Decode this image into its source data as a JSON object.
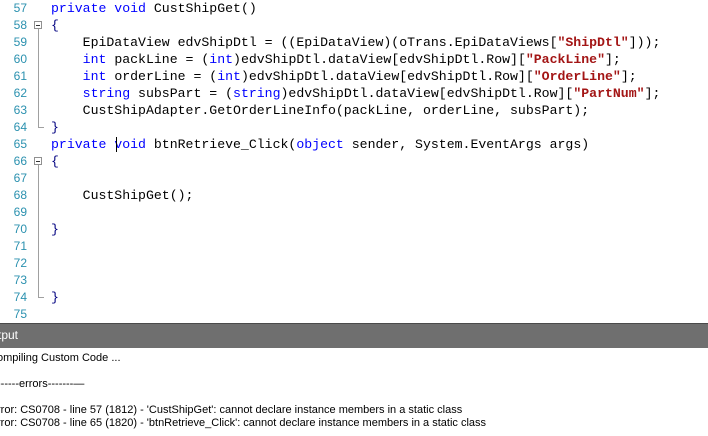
{
  "editor": {
    "lines": [
      {
        "num": "57",
        "fold": "none",
        "tokens": [
          {
            "t": "private void ",
            "c": "kw"
          },
          {
            "t": "CustShipGet()",
            "c": ""
          }
        ]
      },
      {
        "num": "58",
        "fold": "open",
        "tokens": [
          {
            "t": "{",
            "c": "brace"
          }
        ]
      },
      {
        "num": "59",
        "fold": "line",
        "tokens": [
          {
            "t": "    EpiDataView edvShipDtl = ((EpiDataView)(oTrans.EpiDataViews[",
            "c": ""
          },
          {
            "t": "\"ShipDtl\"",
            "c": "str"
          },
          {
            "t": "]));",
            "c": ""
          }
        ]
      },
      {
        "num": "60",
        "fold": "line",
        "tokens": [
          {
            "t": "    ",
            "c": ""
          },
          {
            "t": "int",
            "c": "kw"
          },
          {
            "t": " packLine = (",
            "c": ""
          },
          {
            "t": "int",
            "c": "kw"
          },
          {
            "t": ")edvShipDtl.dataView[edvShipDtl.Row][",
            "c": ""
          },
          {
            "t": "\"PackLine\"",
            "c": "str"
          },
          {
            "t": "];",
            "c": ""
          }
        ]
      },
      {
        "num": "61",
        "fold": "line",
        "tokens": [
          {
            "t": "    ",
            "c": ""
          },
          {
            "t": "int",
            "c": "kw"
          },
          {
            "t": " orderLine = (",
            "c": ""
          },
          {
            "t": "int",
            "c": "kw"
          },
          {
            "t": ")edvShipDtl.dataView[edvShipDtl.Row][",
            "c": ""
          },
          {
            "t": "\"OrderLine\"",
            "c": "str"
          },
          {
            "t": "];",
            "c": ""
          }
        ]
      },
      {
        "num": "62",
        "fold": "line",
        "tokens": [
          {
            "t": "    ",
            "c": ""
          },
          {
            "t": "string",
            "c": "kw"
          },
          {
            "t": " subsPart = (",
            "c": ""
          },
          {
            "t": "string",
            "c": "kw"
          },
          {
            "t": ")edvShipDtl.dataView[edvShipDtl.Row][",
            "c": ""
          },
          {
            "t": "\"PartNum\"",
            "c": "str"
          },
          {
            "t": "];",
            "c": ""
          }
        ]
      },
      {
        "num": "63",
        "fold": "line",
        "tokens": [
          {
            "t": "    CustShipAdapter.GetOrderLineInfo(packLine, orderLine, subsPart);",
            "c": ""
          }
        ]
      },
      {
        "num": "64",
        "fold": "end",
        "tokens": [
          {
            "t": "}",
            "c": "brace"
          }
        ]
      },
      {
        "num": "65",
        "fold": "none",
        "tokens": [
          {
            "t": "private ",
            "c": "kw"
          },
          {
            "t": "void",
            "c": "kw"
          },
          {
            "t": " btnRetrieve_Click(",
            "c": ""
          },
          {
            "t": "object",
            "c": "kw"
          },
          {
            "t": " sender, System.EventArgs args)",
            "c": ""
          }
        ]
      },
      {
        "num": "66",
        "fold": "open",
        "tokens": [
          {
            "t": "{",
            "c": "brace"
          }
        ]
      },
      {
        "num": "67",
        "fold": "line",
        "tokens": []
      },
      {
        "num": "68",
        "fold": "line",
        "tokens": [
          {
            "t": "    CustShipGet();",
            "c": ""
          }
        ]
      },
      {
        "num": "69",
        "fold": "line",
        "tokens": []
      },
      {
        "num": "70",
        "fold": "line",
        "tokens": [
          {
            "t": "}",
            "c": "brace"
          }
        ]
      },
      {
        "num": "71",
        "fold": "line",
        "tokens": []
      },
      {
        "num": "72",
        "fold": "line",
        "tokens": []
      },
      {
        "num": "73",
        "fold": "line",
        "tokens": []
      },
      {
        "num": "74",
        "fold": "end",
        "tokens": [
          {
            "t": "}",
            "c": "brace"
          }
        ]
      },
      {
        "num": "75",
        "fold": "none",
        "tokens": []
      }
    ]
  },
  "output": {
    "title": "tput",
    "lines": [
      "ompiling Custom Code ...",
      "",
      "------errors-------—",
      "",
      "rror: CS0708 - line 57 (1812) - 'CustShipGet': cannot declare instance members in a static class",
      "rror: CS0708 - line 65 (1820) - 'btnRetrieve_Click': cannot declare instance members in a static class"
    ]
  }
}
